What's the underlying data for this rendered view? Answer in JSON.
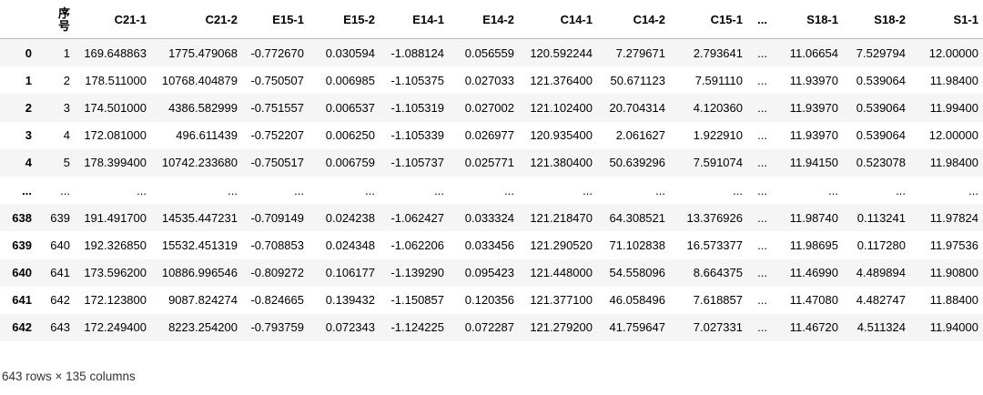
{
  "table": {
    "columns": [
      "",
      "序号",
      "C21-1",
      "C21-2",
      "E15-1",
      "E15-2",
      "E14-1",
      "E14-2",
      "C14-1",
      "C14-2",
      "C15-1",
      "...",
      "S18-1",
      "S18-2",
      "S1-1"
    ],
    "rows": [
      [
        "0",
        "1",
        "169.648863",
        "1775.479068",
        "-0.772670",
        "0.030594",
        "-1.088124",
        "0.056559",
        "120.592244",
        "7.279671",
        "2.793641",
        "...",
        "11.06654",
        "7.529794",
        "12.00000"
      ],
      [
        "1",
        "2",
        "178.511000",
        "10768.404879",
        "-0.750507",
        "0.006985",
        "-1.105375",
        "0.027033",
        "121.376400",
        "50.671123",
        "7.591110",
        "...",
        "11.93970",
        "0.539064",
        "11.98400"
      ],
      [
        "2",
        "3",
        "174.501000",
        "4386.582999",
        "-0.751557",
        "0.006537",
        "-1.105319",
        "0.027002",
        "121.102400",
        "20.704314",
        "4.120360",
        "...",
        "11.93970",
        "0.539064",
        "11.99400"
      ],
      [
        "3",
        "4",
        "172.081000",
        "496.611439",
        "-0.752207",
        "0.006250",
        "-1.105339",
        "0.026977",
        "120.935400",
        "2.061627",
        "1.922910",
        "...",
        "11.93970",
        "0.539064",
        "12.00000"
      ],
      [
        "4",
        "5",
        "178.399400",
        "10742.233680",
        "-0.750517",
        "0.006759",
        "-1.105737",
        "0.025771",
        "121.380400",
        "50.639296",
        "7.591074",
        "...",
        "11.94150",
        "0.523078",
        "11.98400"
      ],
      [
        "...",
        "...",
        "...",
        "...",
        "...",
        "...",
        "...",
        "...",
        "...",
        "...",
        "...",
        "...",
        "...",
        "...",
        "..."
      ],
      [
        "638",
        "639",
        "191.491700",
        "14535.447231",
        "-0.709149",
        "0.024238",
        "-1.062427",
        "0.033324",
        "121.218470",
        "64.308521",
        "13.376926",
        "...",
        "11.98740",
        "0.113241",
        "11.97824"
      ],
      [
        "639",
        "640",
        "192.326850",
        "15532.451319",
        "-0.708853",
        "0.024348",
        "-1.062206",
        "0.033456",
        "121.290520",
        "71.102838",
        "16.573377",
        "...",
        "11.98695",
        "0.117280",
        "11.97536"
      ],
      [
        "640",
        "641",
        "173.596200",
        "10886.996546",
        "-0.809272",
        "0.106177",
        "-1.139290",
        "0.095423",
        "121.448000",
        "54.558096",
        "8.664375",
        "...",
        "11.46990",
        "4.489894",
        "11.90800"
      ],
      [
        "641",
        "642",
        "172.123800",
        "9087.824274",
        "-0.824665",
        "0.139432",
        "-1.150857",
        "0.120356",
        "121.377100",
        "46.058496",
        "7.618857",
        "...",
        "11.47080",
        "4.482747",
        "11.88400"
      ],
      [
        "642",
        "643",
        "172.249400",
        "8223.254200",
        "-0.793759",
        "0.072343",
        "-1.124225",
        "0.072287",
        "121.279200",
        "41.759647",
        "7.027331",
        "...",
        "11.46720",
        "4.511324",
        "11.94000"
      ]
    ]
  },
  "footer": {
    "shape_text": "643 rows × 135 columns"
  }
}
